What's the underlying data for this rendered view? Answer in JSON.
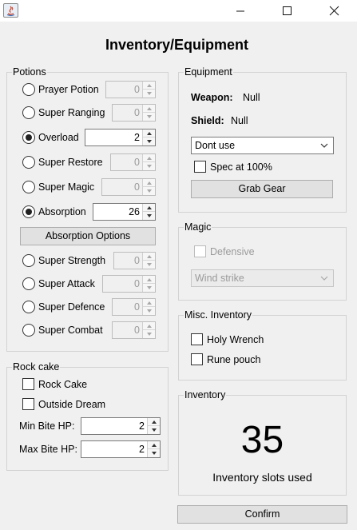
{
  "window": {
    "title": ""
  },
  "title": "Inventory/Equipment",
  "potions": {
    "title": "Potions",
    "items": [
      {
        "label": "Prayer Potion",
        "checked": false,
        "value": "0",
        "enabled": false
      },
      {
        "label": "Super Ranging",
        "checked": false,
        "value": "0",
        "enabled": false
      },
      {
        "label": "Overload",
        "checked": true,
        "value": "2",
        "enabled": true
      },
      {
        "label": "Super Restore",
        "checked": false,
        "value": "0",
        "enabled": false
      },
      {
        "label": "Super Magic",
        "checked": false,
        "value": "0",
        "enabled": false
      },
      {
        "label": "Absorption",
        "checked": true,
        "value": "26",
        "enabled": true
      },
      {
        "label": "Super Strength",
        "checked": false,
        "value": "0",
        "enabled": false
      },
      {
        "label": "Super Attack",
        "checked": false,
        "value": "0",
        "enabled": false
      },
      {
        "label": "Super Defence",
        "checked": false,
        "value": "0",
        "enabled": false
      },
      {
        "label": "Super Combat",
        "checked": false,
        "value": "0",
        "enabled": false
      }
    ],
    "absorption_options_label": "Absorption Options"
  },
  "rockcake": {
    "title": "Rock cake",
    "rock_cake_label": "Rock Cake",
    "outside_dream_label": "Outside Dream",
    "min_label": "Min Bite HP:",
    "min_value": "2",
    "max_label": "Max Bite HP:",
    "max_value": "2"
  },
  "equipment": {
    "title": "Equipment",
    "weapon_label": "Weapon:",
    "weapon_value": "Null",
    "shield_label": "Shield:",
    "shield_value": "Null",
    "spec_select": "Dont use",
    "spec_label": "Spec at 100%",
    "grab_label": "Grab Gear"
  },
  "magic": {
    "title": "Magic",
    "defensive_label": "Defensive",
    "spell_select": "Wind strike"
  },
  "misc": {
    "title": "Misc. Inventory",
    "holy_wrench_label": "Holy Wrench",
    "rune_pouch_label": "Rune pouch"
  },
  "inventory": {
    "title": "Inventory",
    "count": "35",
    "caption": "Inventory slots used"
  },
  "confirm_label": "Confirm"
}
